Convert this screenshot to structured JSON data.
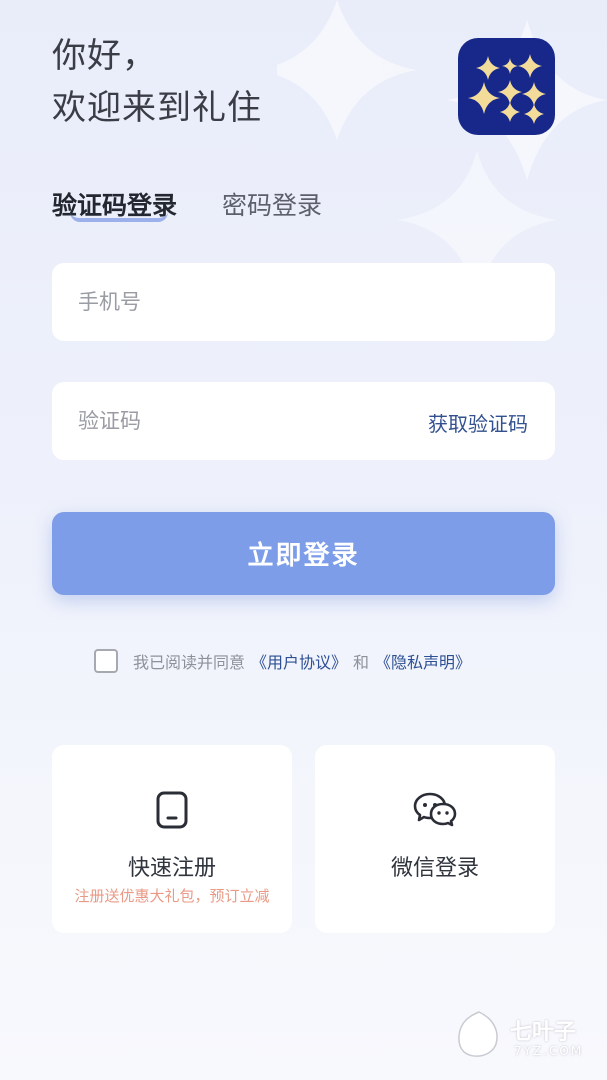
{
  "greeting": {
    "line1": "你好，",
    "line2": "欢迎来到礼住"
  },
  "tabs": {
    "sms_login": "验证码登录",
    "password_login": "密码登录"
  },
  "phone_field": {
    "placeholder": "手机号",
    "value": ""
  },
  "code_field": {
    "placeholder": "验证码",
    "value": "",
    "get_code_label": "获取验证码"
  },
  "login_button": {
    "label": "立即登录"
  },
  "agreement": {
    "prefix": "我已阅读并同意",
    "user_agreement": "《用户协议》",
    "conjunction": "和",
    "privacy_policy": "《隐私声明》",
    "checked": false
  },
  "cards": {
    "register": {
      "title": "快速注册",
      "subtitle": "注册送优惠大礼包，预订立减",
      "icon": "phone-icon"
    },
    "wechat": {
      "title": "微信登录",
      "icon": "wechat-icon"
    }
  },
  "watermark": {
    "text": "七叶子",
    "sub": "7YZ.COM"
  },
  "colors": {
    "primary_button": "#7d9de8",
    "link": "#2d4f94",
    "logo_bg": "#17288a",
    "logo_star": "#f3dc9a",
    "promo_text": "#e89a86"
  }
}
